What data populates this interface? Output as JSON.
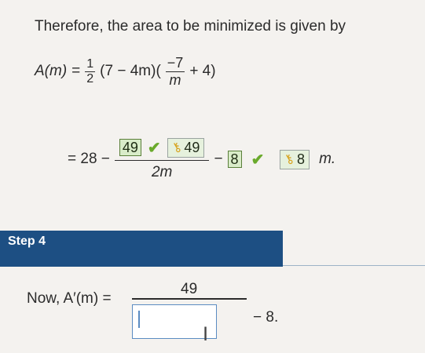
{
  "intro_text": "Therefore, the area to be minimized is given by",
  "line1": {
    "lhs": "A(m)",
    "eq": "=",
    "half_num": "1",
    "half_den": "2",
    "paren": "(7 − 4m)(",
    "frac_num": "−7",
    "frac_den": "m",
    "tail": "+ 4)"
  },
  "line2": {
    "eq": "= 28 −",
    "answer1": "49",
    "key_value1": "49",
    "den": "2m",
    "minus": "−",
    "answer2": "8",
    "key_value2": "8",
    "unit": "m."
  },
  "step": {
    "label": "Step 4"
  },
  "line3": {
    "lead": "Now, A′(m) =",
    "num": "49",
    "tail": "− 8."
  },
  "colors": {
    "step_band": "#1d4f83",
    "check": "#6aaa2c",
    "answer_box": "#d9ecc9",
    "input_border": "#5b8cc2"
  },
  "icons": {
    "check": "check-icon",
    "key": "key-icon",
    "cursor": "ibeam-cursor-icon"
  }
}
